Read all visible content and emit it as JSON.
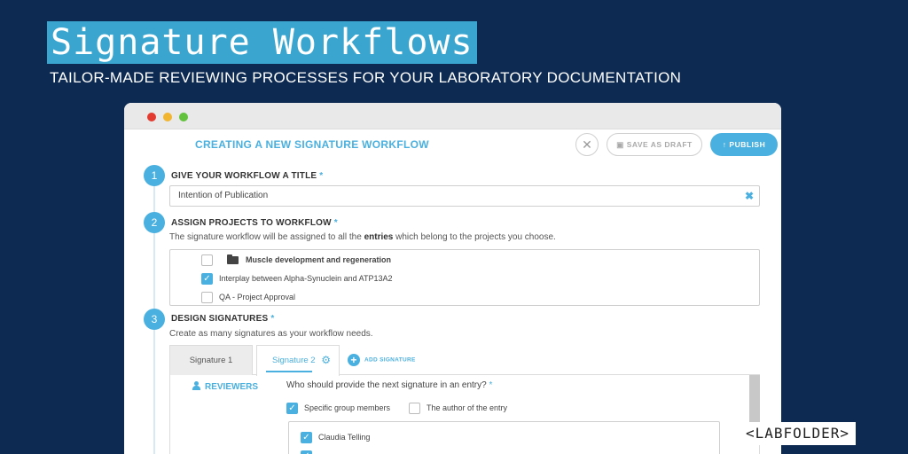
{
  "hero": {
    "title": "Signature Workflows",
    "subtitle": "TAILOR-MADE REVIEWING PROCESSES FOR YOUR LABORATORY DOCUMENTATION"
  },
  "app": {
    "header_title": "CREATING A NEW SIGNATURE WORKFLOW",
    "close_glyph": "✕",
    "save_draft_label": "SAVE AS DRAFT",
    "publish_label": "PUBLISH"
  },
  "step1": {
    "number": "1",
    "title": "GIVE YOUR WORKFLOW A TITLE",
    "required_mark": "*",
    "input_value": "Intention of Publication",
    "clear_glyph": "✖"
  },
  "step2": {
    "number": "2",
    "title": "ASSIGN PROJECTS TO WORKFLOW",
    "required_mark": "*",
    "desc_prefix": "The signature workflow will be assigned to all the ",
    "desc_bold": "entries",
    "desc_suffix": " which belong to the projects you choose.",
    "projects": [
      {
        "label": "Muscle development and regeneration",
        "checked": false,
        "is_folder": true
      },
      {
        "label": "Interplay between Alpha-Synuclein and ATP13A2",
        "checked": true,
        "is_folder": false
      },
      {
        "label": "QA - Project Approval",
        "checked": false,
        "is_folder": false
      }
    ]
  },
  "step3": {
    "number": "3",
    "title": "DESIGN SIGNATURES",
    "required_mark": "*",
    "desc": "Create as many signatures as your workflow needs.",
    "tabs": [
      {
        "label": "Signature 1"
      },
      {
        "label": "Signature 2"
      }
    ],
    "add_signature_label": "ADD SIGNATURE",
    "reviewers_label": "REVIEWERS",
    "question": "Who should provide the next signature in an entry?",
    "question_required": "*",
    "options": [
      {
        "label": "Specific group members",
        "checked": true
      },
      {
        "label": "The author of the entry",
        "checked": false
      }
    ],
    "members": [
      {
        "label": "Claudia Telling",
        "checked": true
      },
      {
        "label": "",
        "checked": true
      }
    ]
  },
  "logo": {
    "left": "<",
    "lab": "LAB",
    "folder": "FOLDER",
    "right": ">"
  },
  "colors": {
    "background": "#0d2a52",
    "accent": "#4ab0df",
    "title_highlight": "#3aa6cf"
  }
}
